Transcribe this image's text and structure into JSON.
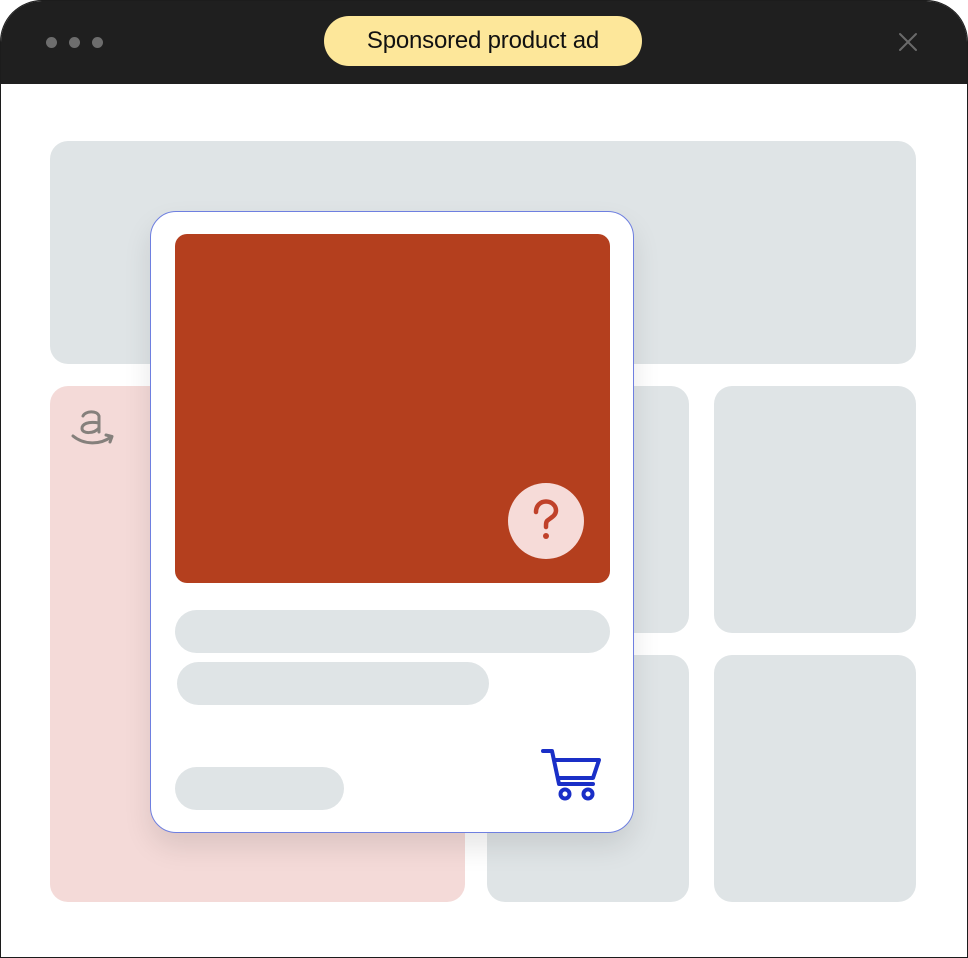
{
  "window": {
    "badge_label": "Sponsored product ad"
  },
  "icons": {
    "window_dots": "ellipsis-icon",
    "close": "close-icon",
    "brand_logo": "amazon-logo-icon",
    "help": "question-mark-icon",
    "cart": "shopping-cart-icon"
  },
  "colors": {
    "title_bar": "#1f1f1f",
    "badge": "#fde79a",
    "placeholder": "#dfe4e6",
    "brand_tile": "#f4dad8",
    "product_image": "#b43f1e",
    "help_button": "#f6dbd8",
    "accent": "#1a2fc7",
    "card_border": "#6e7fe0"
  }
}
